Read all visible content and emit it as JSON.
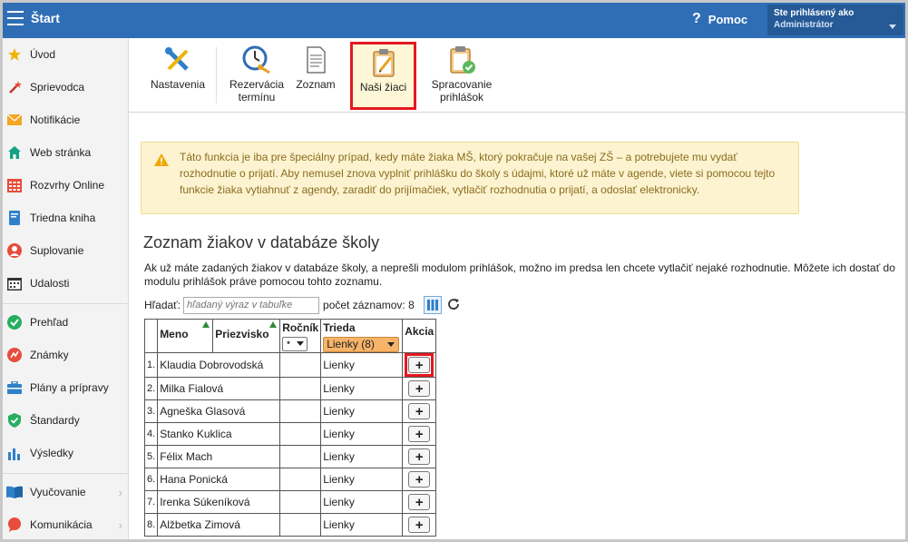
{
  "header": {
    "app_title": "Štart",
    "help_label": "Pomoc",
    "user_line1": "Ste prihlásený ako",
    "user_line2": "Administrátor"
  },
  "sidebar": {
    "items": [
      {
        "label": "Úvod",
        "icon": "star-icon"
      },
      {
        "label": "Sprievodca",
        "icon": "wand-icon"
      },
      {
        "label": "Notifikácie",
        "icon": "envelope-icon"
      },
      {
        "label": "Web stránka",
        "icon": "house-icon"
      },
      {
        "label": "Rozvrhy Online",
        "icon": "calendar-grid-icon"
      },
      {
        "label": "Triedna kniha",
        "icon": "book-icon"
      },
      {
        "label": "Suplovanie",
        "icon": "person-icon"
      },
      {
        "label": "Udalosti",
        "icon": "calendar-icon"
      },
      {
        "label": "Prehľad",
        "icon": "check-circle-icon"
      },
      {
        "label": "Známky",
        "icon": "grades-icon"
      },
      {
        "label": "Plány a prípravy",
        "icon": "briefcase-icon"
      },
      {
        "label": "Štandardy",
        "icon": "shield-check-icon"
      },
      {
        "label": "Výsledky",
        "icon": "bar-chart-icon"
      },
      {
        "label": "Vyučovanie",
        "icon": "open-book-icon"
      },
      {
        "label": "Komunikácia",
        "icon": "chat-icon"
      }
    ]
  },
  "toolbar": {
    "buttons": [
      {
        "label": "Nastavenia",
        "icon": "tools-icon"
      },
      {
        "label_line1": "Rezervácia",
        "label_line2": "termínu",
        "icon": "clock-key-icon"
      },
      {
        "label": "Zoznam",
        "icon": "document-icon"
      },
      {
        "label": "Naši žiaci",
        "icon": "clipboard-pencil-icon"
      },
      {
        "label_line1": "Spracovanie",
        "label_line2": "prihlášok",
        "icon": "clipboard-check-icon"
      }
    ]
  },
  "alert": {
    "text": "Táto funkcia je iba pre špeciálny prípad, kedy máte žiaka MŠ, ktorý pokračuje na vašej ZŠ – a potrebujete mu vydať rozhodnutie o prijatí. Aby nemusel znova vyplniť prihlášku do školy s údajmi, ktoré už máte v agende, viete si pomocou tejto funkcie žiaka vytiahnuť z agendy, zaradiť do prijímačiek, vytlačiť rozhodnutia o prijatí, a odoslať elektronicky."
  },
  "section": {
    "title": "Zoznam žiakov v databáze školy",
    "description": "Ak už máte zadaných žiakov v databáze školy, a neprešli modulom prihlášok, možno im predsa len chcete vytlačiť nejaké rozhodnutie. Môžete ich dostať do modulu prihlášok práve pomocou tohto zoznamu."
  },
  "search": {
    "label": "Hľadať:",
    "placeholder": "hľadaný výraz v tabuľke",
    "count_label": "počet záznamov: 8"
  },
  "table": {
    "columns": {
      "meno": "Meno",
      "priezvisko": "Priezvisko",
      "rocnik": "Ročník",
      "trieda": "Trieda",
      "akcia": "Akcia"
    },
    "rocnik_filter": "*",
    "trieda_filter": "Lienky (8)",
    "rows": [
      {
        "num": "1.",
        "name": "Klaudia Dobrovodská",
        "trieda": "Lienky"
      },
      {
        "num": "2.",
        "name": "Milka Fialová",
        "trieda": "Lienky"
      },
      {
        "num": "3.",
        "name": "Agneška Glasová",
        "trieda": "Lienky"
      },
      {
        "num": "4.",
        "name": "Stanko Kuklica",
        "trieda": "Lienky"
      },
      {
        "num": "5.",
        "name": "Félix Mach",
        "trieda": "Lienky"
      },
      {
        "num": "6.",
        "name": "Hana Ponická",
        "trieda": "Lienky"
      },
      {
        "num": "7.",
        "name": "Irenka Súkeníková",
        "trieda": "Lienky"
      },
      {
        "num": "8.",
        "name": "Alžbetka Zimová",
        "trieda": "Lienky"
      }
    ],
    "add_label": "+"
  },
  "colors": {
    "topbar": "#2f6eb5",
    "highlight": "#e4181f",
    "alert_bg": "#fdf3d0",
    "filter_orange": "#f7b469"
  }
}
